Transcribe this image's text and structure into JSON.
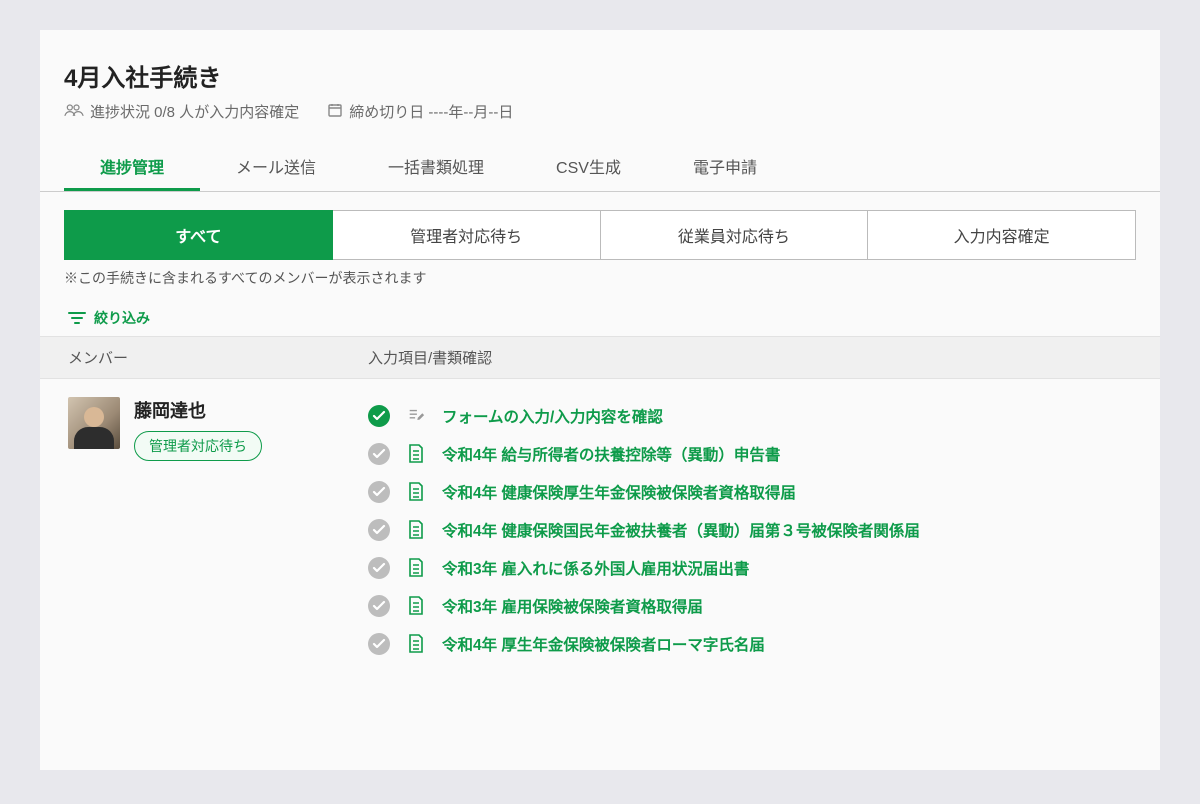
{
  "header": {
    "title": "4月入社手続き",
    "progress_label": "進捗状況 0/8 人が入力内容確定",
    "deadline_label": "締め切り日 ----年--月--日"
  },
  "tabs": {
    "progress": "進捗管理",
    "mail": "メール送信",
    "batch": "一括書類処理",
    "csv": "CSV生成",
    "eapply": "電子申請"
  },
  "filter_tabs": {
    "all": "すべて",
    "admin_wait": "管理者対応待ち",
    "employee_wait": "従業員対応待ち",
    "confirmed": "入力内容確定"
  },
  "note": "※この手続きに含まれるすべてのメンバーが表示されます",
  "refine_label": "絞り込み",
  "table": {
    "header_member": "メンバー",
    "header_items": "入力項目/書類確認"
  },
  "member": {
    "name": "藤岡達也",
    "status": "管理者対応待ち"
  },
  "items": {
    "0": "フォームの入力/入力内容を確認",
    "1": "令和4年 給与所得者の扶養控除等（異動）申告書",
    "2": "令和4年 健康保険厚生年金保険被保険者資格取得届",
    "3": "令和4年 健康保険国民年金被扶養者（異動）届第３号被保険者関係届",
    "4": "令和3年 雇入れに係る外国人雇用状況届出書",
    "5": "令和3年 雇用保険被保険者資格取得届",
    "6": "令和4年 厚生年金保険被保険者ローマ字氏名届"
  }
}
